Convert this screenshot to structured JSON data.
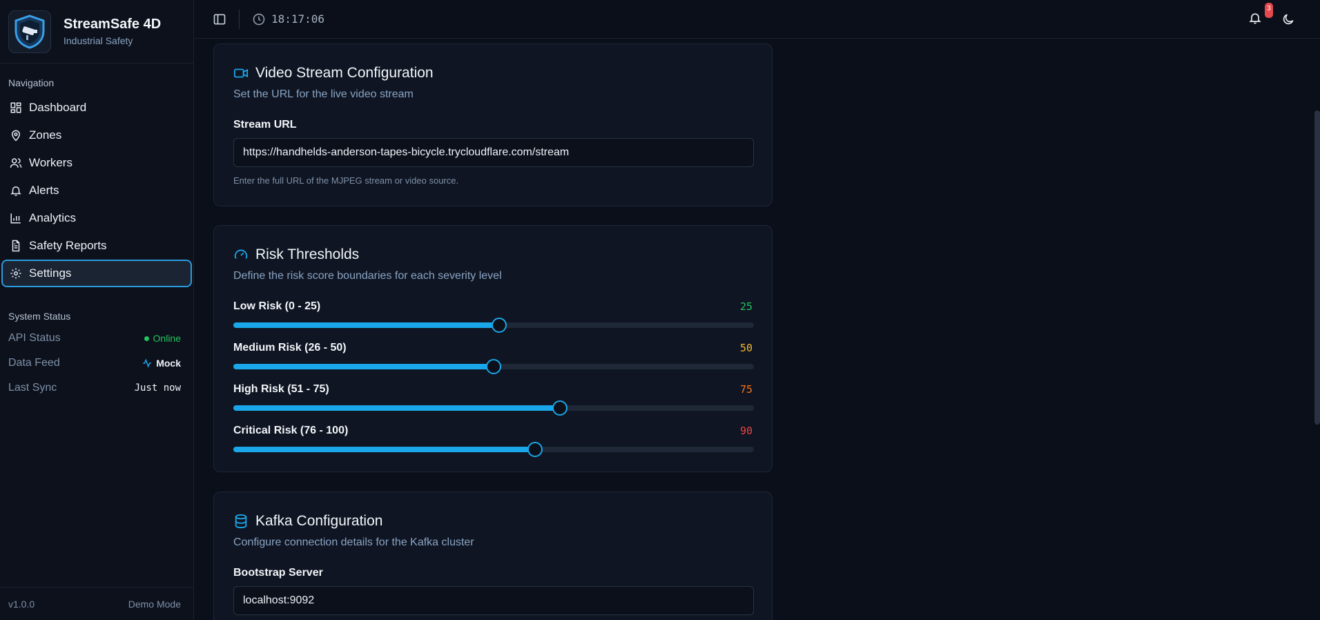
{
  "brand": {
    "title": "StreamSafe 4D",
    "subtitle": "Industrial Safety"
  },
  "nav": {
    "heading": "Navigation",
    "items": [
      {
        "label": "Dashboard",
        "icon": "dashboard-icon"
      },
      {
        "label": "Zones",
        "icon": "map-pin-icon"
      },
      {
        "label": "Workers",
        "icon": "users-icon"
      },
      {
        "label": "Alerts",
        "icon": "bell-icon"
      },
      {
        "label": "Analytics",
        "icon": "bar-chart-icon"
      },
      {
        "label": "Safety Reports",
        "icon": "file-text-icon"
      },
      {
        "label": "Settings",
        "icon": "gear-icon",
        "active": true
      }
    ]
  },
  "system_status": {
    "heading": "System Status",
    "api_label": "API Status",
    "api_value": "Online",
    "feed_label": "Data Feed",
    "feed_value": "Mock",
    "sync_label": "Last Sync",
    "sync_value": "Just now"
  },
  "footer": {
    "version": "v1.0.0",
    "mode": "Demo Mode"
  },
  "header": {
    "time": "18:17:06",
    "notification_count": "3"
  },
  "video": {
    "title": "Video Stream Configuration",
    "subtitle": "Set the URL for the live video stream",
    "field_label": "Stream URL",
    "url": "https://handhelds-anderson-tapes-bicycle.trycloudflare.com/stream",
    "hint": "Enter the full URL of the MJPEG stream or video source."
  },
  "risk": {
    "title": "Risk Thresholds",
    "subtitle": "Define the risk score boundaries for each severity level",
    "sliders": [
      {
        "label": "Low Risk (0 - 25)",
        "value": "25",
        "color": "#22c55e",
        "fill": 0.51
      },
      {
        "label": "Medium Risk (26 - 50)",
        "value": "50",
        "color": "#f5b82e",
        "fill": 0.5
      },
      {
        "label": "High Risk (51 - 75)",
        "value": "75",
        "color": "#f97316",
        "fill": 0.627
      },
      {
        "label": "Critical Risk (76 - 100)",
        "value": "90",
        "color": "#ef4444",
        "fill": 0.58
      }
    ]
  },
  "kafka": {
    "title": "Kafka Configuration",
    "subtitle": "Configure connection details for the Kafka cluster",
    "field_label": "Bootstrap Server",
    "server": "localhost:9092"
  },
  "colors": {
    "accent": "#1aa7ea",
    "background": "#0b0f19",
    "card": "#0f1522"
  }
}
